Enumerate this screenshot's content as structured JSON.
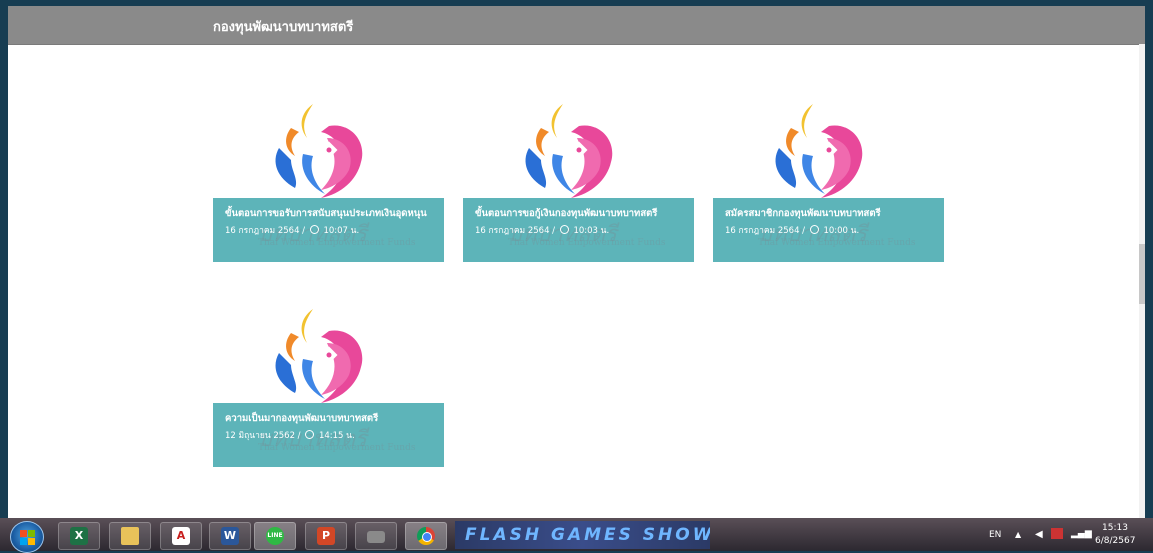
{
  "header": {
    "title": "กองทุนพัฒนาบทบาทสตรี"
  },
  "cards": [
    {
      "title": "ขั้นตอนการขอรับการสนับสนุนประเภทเงินอุดหนุน",
      "date": "16 กรกฎาคม 2564",
      "time": "10:07 น.",
      "ghost": "บทบาทสตรี",
      "ghost_sub": "Thai Women Empowerment Funds"
    },
    {
      "title": "ขั้นตอนการขอกู้เงินกองทุนพัฒนาบทบาทสตรี",
      "date": "16 กรกฎาคม 2564",
      "time": "10:03 น.",
      "ghost": "บทบาทสตรี",
      "ghost_sub": "Thai Women Empowerment Funds"
    },
    {
      "title": "สมัครสมาชิกกองทุนพัฒนาบทบาทสตรี",
      "date": "16 กรกฎาคม 2564",
      "time": "10:00 น.",
      "ghost": "บทบาทสตรี",
      "ghost_sub": "Thai Women Empowerment Funds"
    },
    {
      "title": "ความเป็นมากองทุนพัฒนาบทบาทสตรี",
      "date": "12 มิถุนายน 2562",
      "time": "14:15 น.",
      "ghost": "บทบาทสตรี",
      "ghost_sub": "Thai Women Empowerment Funds"
    }
  ],
  "taskbar": {
    "apps": [
      {
        "name": "excel-icon",
        "glyph": "X",
        "color": "#1e7145"
      },
      {
        "name": "folder-icon",
        "glyph": "",
        "color": "#e8c25a"
      },
      {
        "name": "acrobat-icon",
        "glyph": "A",
        "color": "#c8201e"
      },
      {
        "name": "word-icon",
        "glyph": "W",
        "color": "#2b579a"
      },
      {
        "name": "line-icon",
        "glyph": "LINE",
        "color": "#2fb944"
      },
      {
        "name": "powerpoint-icon",
        "glyph": "P",
        "color": "#d24726"
      },
      {
        "name": "printer-icon",
        "glyph": "",
        "color": "#8a8a8a"
      },
      {
        "name": "chrome-icon",
        "glyph": "",
        "color": "#db4437"
      }
    ],
    "banner": "FLASH GAMES SHOW",
    "lang": "EN",
    "time": "15:13",
    "date": "6/8/2567"
  },
  "colors": {
    "header": "#8a8a8a",
    "card_band": "#5db4b9",
    "logo_pink": "#e8489a",
    "logo_blue": "#2a6fd6",
    "logo_orange": "#f08a2a",
    "logo_yellow": "#f2c230"
  }
}
